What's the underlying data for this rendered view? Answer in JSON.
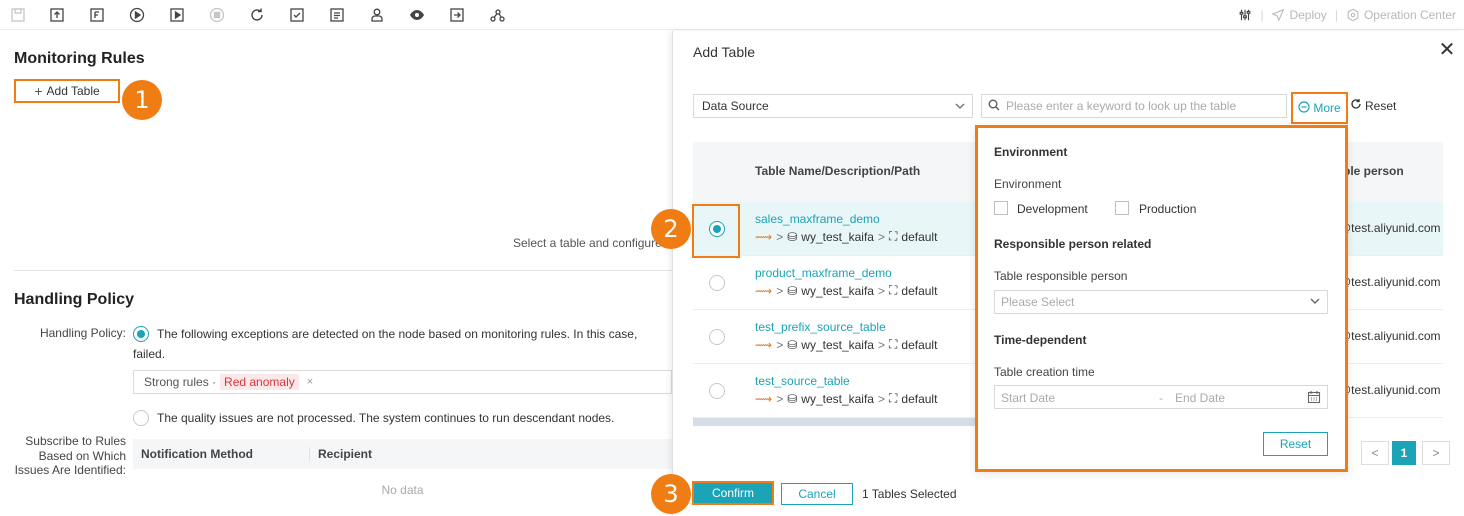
{
  "toolbar": {
    "icons": [
      "save-icon",
      "upload-icon",
      "format-icon",
      "run-icon",
      "run-params-icon",
      "stop-icon",
      "refresh-icon",
      "check-icon",
      "log-icon",
      "person-icon",
      "preview-icon",
      "export-icon",
      "graph-icon"
    ],
    "settings_icon": "sliders-icon",
    "deploy_label": "Deploy",
    "operation_center_label": "Operation Center"
  },
  "left": {
    "monitoring_title": "Monitoring Rules",
    "add_table_label": "Add Table",
    "callout_1": "1",
    "hint": "Select a table and configure",
    "handling_title": "Handling Policy",
    "handling_label": "Handling Policy:",
    "option1_line1": "The following exceptions are detected on the node based on monitoring rules. In this case,",
    "option1_line2": "failed.",
    "tag_prefix": "Strong rules ·",
    "tag_value": "Red anomaly",
    "tag_close": "×",
    "option2": "The quality issues are not processed. The system continues to run descendant nodes.",
    "subscribe_label": "Subscribe to Rules Based on Which Issues Are Identified:",
    "notif_col1": "Notification Method",
    "notif_col2": "Recipient",
    "no_data": "No data"
  },
  "dialog": {
    "title": "Add Table",
    "close": "✕",
    "data_source_label": "Data Source",
    "search_placeholder": "Please enter a keyword to look up the table",
    "more_label": "More",
    "reset_label": "Reset",
    "col_name": "Table Name/Description/Path",
    "col_owner": "ble person",
    "callout_2": "2",
    "callout_3": "3",
    "rows": [
      {
        "name": "sales_maxframe_demo",
        "project": "wy_test_kaifa",
        "schema": "default",
        "owner": "@test.aliyunid.com",
        "selected": true
      },
      {
        "name": "product_maxframe_demo",
        "project": "wy_test_kaifa",
        "schema": "default",
        "owner": "@test.aliyunid.com",
        "selected": false
      },
      {
        "name": "test_prefix_source_table",
        "project": "wy_test_kaifa",
        "schema": "default",
        "owner": "@test.aliyunid.com",
        "selected": false
      },
      {
        "name": "test_source_table",
        "project": "wy_test_kaifa",
        "schema": "default",
        "owner": "@test.aliyunid.com",
        "selected": false
      }
    ],
    "popover": {
      "env_heading": "Environment",
      "env_label": "Environment",
      "env_dev": "Development",
      "env_prod": "Production",
      "resp_heading": "Responsible person related",
      "resp_label": "Table responsible person",
      "resp_placeholder": "Please Select",
      "time_heading": "Time-dependent",
      "time_label": "Table creation time",
      "start_placeholder": "Start Date",
      "date_sep": "-",
      "end_placeholder": "End Date",
      "reset_label": "Reset"
    },
    "pager": {
      "prev": "<",
      "current": "1",
      "next": ">"
    },
    "confirm_label": "Confirm",
    "cancel_label": "Cancel",
    "selected_text": "1 Tables Selected"
  },
  "colors": {
    "accent": "#1ba3b8",
    "highlight": "#f07c14",
    "tag_red": "#d9363e"
  }
}
